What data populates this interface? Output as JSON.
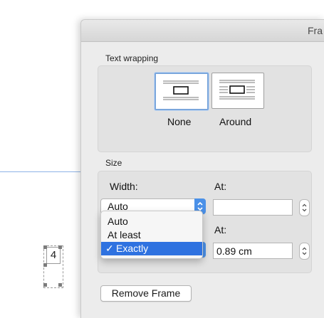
{
  "document": {
    "frame_number": "4"
  },
  "dialog": {
    "title": "Fra",
    "text_wrapping": {
      "label": "Text wrapping",
      "options": [
        {
          "label": "None",
          "selected": true,
          "icon": "wrap-none-icon"
        },
        {
          "label": "Around",
          "selected": false,
          "icon": "wrap-around-icon"
        }
      ]
    },
    "size": {
      "label": "Size",
      "width_label": "Width:",
      "width_value": "Auto",
      "width_at_label": "At:",
      "width_at_value": "",
      "height_at_label": "At:",
      "height_at_value": "0.89 cm"
    },
    "dropdown_menu": {
      "items": [
        {
          "label": "Auto",
          "selected": false
        },
        {
          "label": "At least",
          "selected": false
        },
        {
          "label": "Exactly",
          "selected": true
        }
      ],
      "check_mark": "✓"
    },
    "remove_frame_label": "Remove Frame"
  },
  "colors": {
    "accent": "#2f72e0",
    "selection_border": "#7aa6dc"
  }
}
